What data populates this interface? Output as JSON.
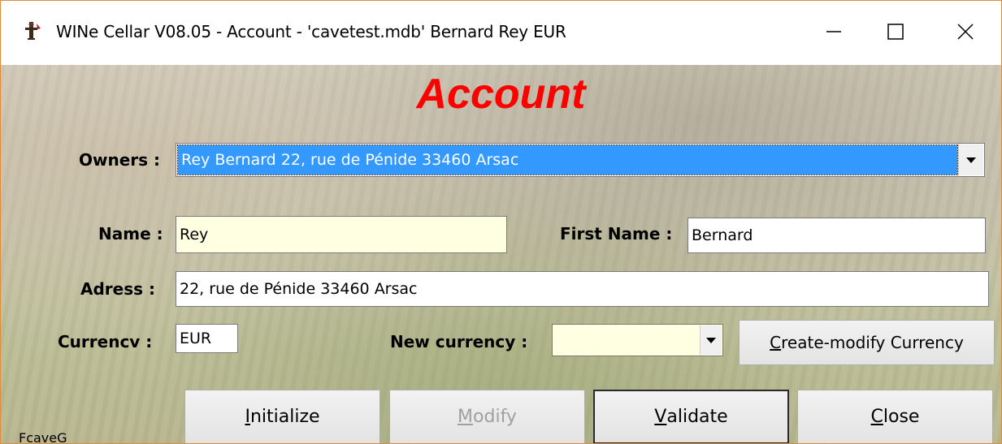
{
  "window": {
    "title": "WINe Cellar V08.05  - Account -  'cavetest.mdb'   Bernard Rey   EUR",
    "icon": "wine-cellar-app-icon",
    "controls": [
      "minimize-icon",
      "maximize-icon",
      "close-icon"
    ]
  },
  "form": {
    "heading": "Account",
    "owners_label": "Owners :",
    "owners_value": "Rey Bernard 22, rue de Pénide 33460 Arsac",
    "name_label": "Name :",
    "name_value": "Rey",
    "first_name_label": "First Name :",
    "first_name_value": "Bernard",
    "address_label": "Adress :",
    "address_value": "22, rue de Pénide 33460 Arsac",
    "currency_label": "Currencv :",
    "currency_value": "EUR",
    "new_currency_label": "New currency :",
    "new_currency_value": ""
  },
  "buttons": {
    "create_modify_currency_pre": "C",
    "create_modify_currency_rest": "reate-modify Currency",
    "initialize_pre": "I",
    "initialize_rest": "nitialize",
    "modify_pre": "M",
    "modify_rest": "odify",
    "validate_pre": "V",
    "validate_rest": "alidate",
    "close_pre": "C",
    "close_rest": "lose"
  },
  "status": {
    "form_name": "FcaveG"
  },
  "colors": {
    "heading": "#ff0000",
    "selection": "#3399ff",
    "cream_field": "#ffffe1"
  }
}
